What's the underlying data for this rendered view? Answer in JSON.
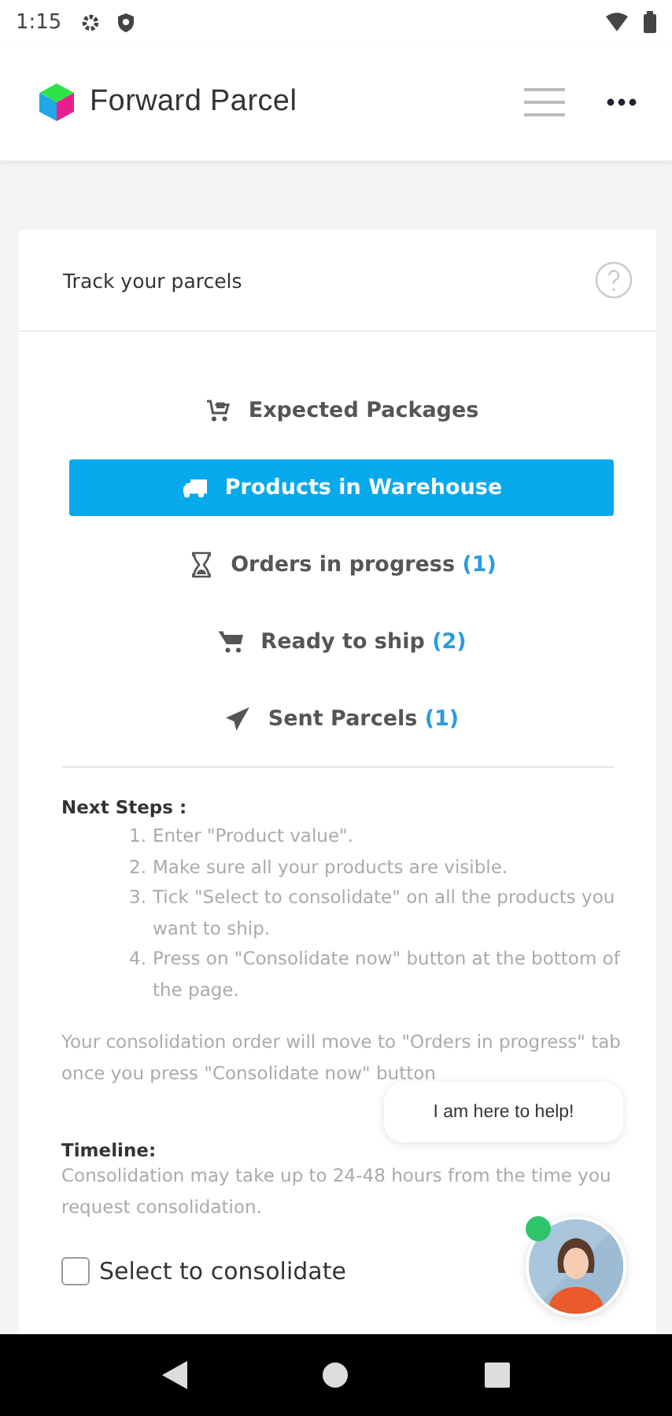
{
  "status_bar": {
    "time": "1:15"
  },
  "app_bar": {
    "title": "Forward Parcel"
  },
  "card": {
    "title": "Track your parcels",
    "tabs": [
      {
        "label": "Expected Packages",
        "selected": false
      },
      {
        "label": "Products in Warehouse",
        "selected": true
      },
      {
        "label": "Orders in progress",
        "count": "(1)",
        "selected": false
      },
      {
        "label": "Ready to ship",
        "count": "(2)",
        "selected": false
      },
      {
        "label": "Sent Parcels",
        "count": "(1)",
        "selected": false
      }
    ],
    "next_steps": {
      "heading": "Next Steps :",
      "items": [
        {
          "number": "1.",
          "text": "Enter \"Product value\"."
        },
        {
          "number": "2.",
          "text": "Make sure all your products are visible."
        },
        {
          "number": "3.",
          "text": "Tick \"Select to consolidate\" on all the products you want to ship."
        },
        {
          "number": "4.",
          "text": "Press on \"Consolidate now\" button at the bottom of the page."
        }
      ]
    },
    "note": "Your consolidation order will move to \"Orders in progress\" tab once you press \"Consolidate now\" button",
    "timeline": {
      "heading": "Timeline:",
      "text": "Consolidation may take up to 24-48 hours from the time you request consolidation."
    },
    "consolidate": {
      "label": "Select to consolidate",
      "checked": false
    }
  },
  "chat": {
    "bubble": "I am here to help!",
    "online": true
  }
}
